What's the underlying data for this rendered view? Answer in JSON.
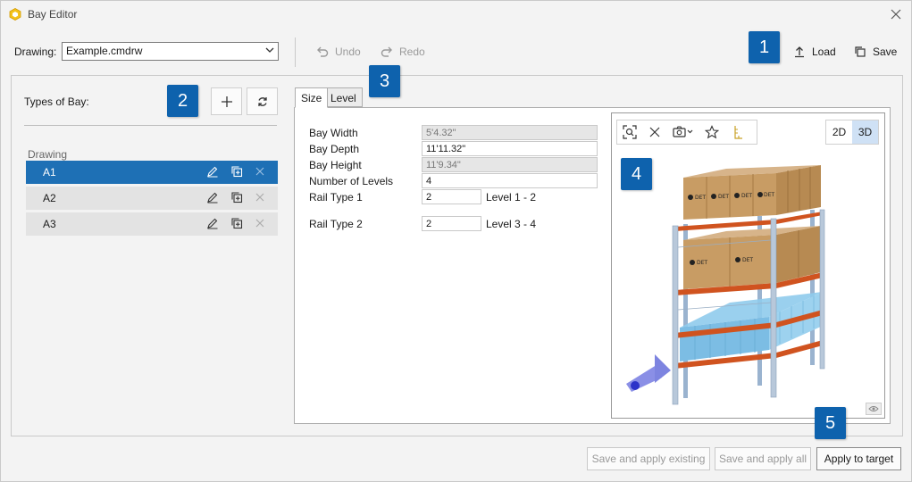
{
  "window": {
    "title": "Bay Editor",
    "app_icon": "hexagon-app-icon",
    "close_icon": "close-icon"
  },
  "toolbar": {
    "drawing_label": "Drawing:",
    "drawing_value": "Example.cmdrw",
    "undo_label": "Undo",
    "redo_label": "Redo",
    "load_label": "Load",
    "save_label": "Save"
  },
  "badges": [
    "1",
    "2",
    "3",
    "4",
    "5"
  ],
  "left_panel": {
    "types_label": "Types of Bay:",
    "group_label": "Drawing",
    "bays": [
      {
        "name": "A1",
        "selected": true
      },
      {
        "name": "A2",
        "selected": false
      },
      {
        "name": "A3",
        "selected": false
      }
    ]
  },
  "tabs": [
    {
      "label": "Size",
      "active": true
    },
    {
      "label": "Level",
      "active": false
    }
  ],
  "properties": {
    "bay_width": {
      "label": "Bay Width",
      "value": "5'4.32\""
    },
    "bay_depth": {
      "label": "Bay Depth",
      "value": "11'11.32\""
    },
    "bay_height": {
      "label": "Bay Height",
      "value": "11'9.34\""
    },
    "num_levels": {
      "label": "Number of Levels",
      "value": "4"
    },
    "rail_type_1": {
      "label": "Rail Type 1",
      "value": "2",
      "note": "Level 1 - 2"
    },
    "rail_type_2": {
      "label": "Rail Type 2",
      "value": "2",
      "note": "Level 3 - 4"
    }
  },
  "viewer": {
    "mode_2d": "2D",
    "mode_3d": "3D",
    "active_mode": "3D",
    "box_label": "DET"
  },
  "footer": {
    "save_apply_existing": "Save and apply existing",
    "save_apply_all": "Save and apply all",
    "apply_target": "Apply to target"
  },
  "colors": {
    "accent": "#1e70b5",
    "badge": "#0e62ad",
    "upright": "#3b6fc2",
    "beam": "#d0531f",
    "box": "#c8a06a",
    "bin": "#7fc3e6"
  }
}
